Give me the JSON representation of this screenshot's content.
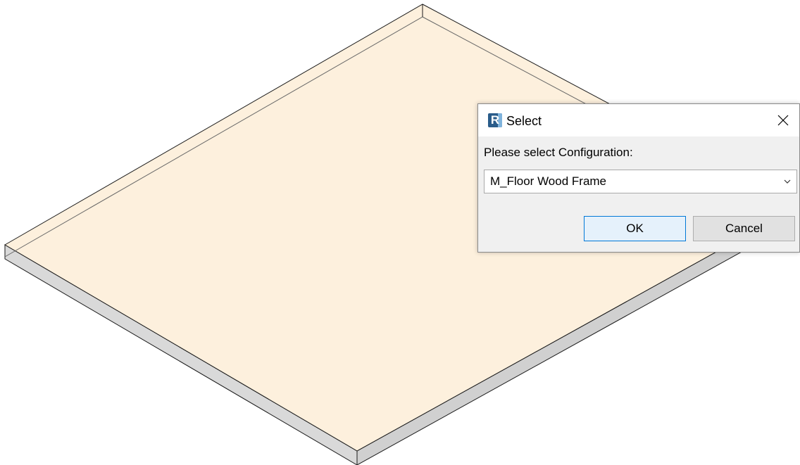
{
  "dialog": {
    "title": "Select",
    "app_icon": "revit-r-icon",
    "app_icon_letter": "R",
    "prompt": "Please select Configuration:",
    "configuration": {
      "selected": "M_Floor Wood Frame"
    },
    "ok_label": "OK",
    "cancel_label": "Cancel",
    "close_icon": "close-x-icon"
  },
  "colors": {
    "floor_top": "#fdf0dd",
    "floor_side": "#d9d9d9",
    "accent": "#0078d7"
  }
}
